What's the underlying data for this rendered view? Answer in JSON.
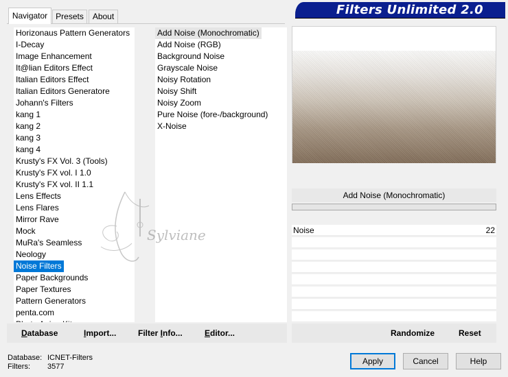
{
  "tabs": [
    {
      "label": "Navigator"
    },
    {
      "label": "Presets"
    },
    {
      "label": "About"
    }
  ],
  "banner": {
    "title": "Filters Unlimited 2.0"
  },
  "categories": {
    "items": [
      "Horizonaus Pattern Generators",
      "I-Decay",
      "Image Enhancement",
      "It@lian Editors Effect",
      "Italian Editors Effect",
      "Italian Editors Generatore",
      "Johann's Filters",
      "kang 1",
      "kang 2",
      "kang 3",
      "kang 4",
      "Krusty's FX Vol. 3 (Tools)",
      "Krusty's FX vol. I 1.0",
      "Krusty's FX vol. II 1.1",
      "Lens Effects",
      "Lens Flares",
      "Mirror Rave",
      "Mock",
      "MuRa's Seamless",
      "Neology",
      "Noise Filters",
      "Paper Backgrounds",
      "Paper Textures",
      "Pattern Generators",
      "penta.com",
      "Photo Aging Kit"
    ],
    "selected": "Noise Filters"
  },
  "filters": {
    "items": [
      "Add Noise (Monochromatic)",
      "Add Noise (RGB)",
      "Background Noise",
      "Grayscale Noise",
      "Noisy Rotation",
      "Noisy Shift",
      "Noisy Zoom",
      "Pure Noise (fore-/background)",
      "X-Noise"
    ],
    "selected": "Add Noise (Monochromatic)"
  },
  "preview": {
    "filter_name": "Add Noise (Monochromatic)"
  },
  "parameters": [
    {
      "label": "Noise",
      "value": "22"
    }
  ],
  "slider": {
    "fraction": 0.0
  },
  "buttons": {
    "database": {
      "underline": "D",
      "rest": "atabase"
    },
    "import": {
      "underline": "I",
      "rest": "mport..."
    },
    "filter_info": {
      "pre": "Filter ",
      "underline": "I",
      "rest": "nfo..."
    },
    "editor": {
      "underline": "E",
      "rest": "ditor..."
    },
    "randomize": "Randomize",
    "reset": "Reset",
    "apply": "Apply",
    "cancel": "Cancel",
    "help": "Help"
  },
  "status": {
    "database_label": "Database:",
    "database_value": "ICNET-Filters",
    "filters_label": "Filters:",
    "filters_value": "3577"
  },
  "watermark": {
    "text": "Sylviane"
  },
  "colors": {
    "selection": "#0078d7",
    "banner": "#0a1f8f"
  }
}
